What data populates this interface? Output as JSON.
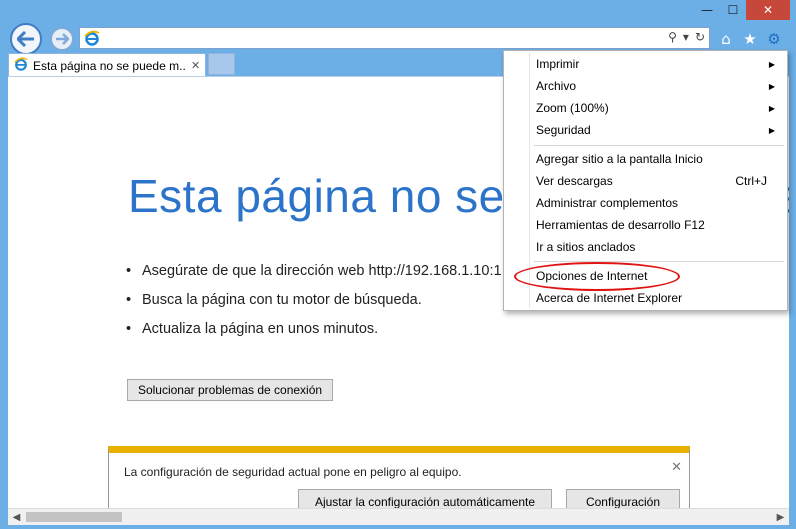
{
  "window": {
    "controls": {
      "minimize": "—",
      "maximize": "☐",
      "close": "✕"
    }
  },
  "addressbar": {
    "value": "",
    "search_glyph": "⚲",
    "dropdown_glyph": "▾",
    "refresh_glyph": "↻"
  },
  "toolbar": {
    "home_glyph": "⌂",
    "favorites_glyph": "★",
    "tools_glyph": "⚙"
  },
  "tab": {
    "title": "Esta página no se puede m...",
    "close_glyph": "✕"
  },
  "page": {
    "heading": "Esta página no se puede mostrar",
    "bullets": [
      "Asegúrate de que la dirección web http://192.168.1.10:1",
      "Busca la página con tu motor de búsqueda.",
      "Actualiza la página en unos minutos."
    ],
    "fix_button": "Solucionar problemas de conexión"
  },
  "notification": {
    "text": "La configuración de seguridad actual pone en peligro al equipo.",
    "auto_button": "Ajustar la configuración automáticamente",
    "config_button": "Configuración",
    "close_glyph": "✕"
  },
  "tools_menu": {
    "items": [
      {
        "label": "Imprimir",
        "submenu": "▶"
      },
      {
        "label": "Archivo",
        "submenu": "▶"
      },
      {
        "label": "Zoom (100%)",
        "submenu": "▶"
      },
      {
        "label": "Seguridad",
        "submenu": "▶"
      },
      {
        "label": "Agregar sitio a la pantalla Inicio"
      },
      {
        "label": "Ver descargas",
        "shortcut": "Ctrl+J"
      },
      {
        "label": "Administrar complementos"
      },
      {
        "label": "Herramientas de desarrollo F12"
      },
      {
        "label": "Ir a sitios anclados"
      },
      {
        "label": "Opciones de Internet"
      },
      {
        "label": "Acerca de Internet Explorer"
      }
    ]
  },
  "scrollbar": {
    "left_glyph": "◀",
    "right_glyph": "▶"
  },
  "colors": {
    "frame": "#6caee6",
    "heading": "#2c74c9",
    "notification_accent": "#e8b000",
    "highlight": "#e01313"
  }
}
